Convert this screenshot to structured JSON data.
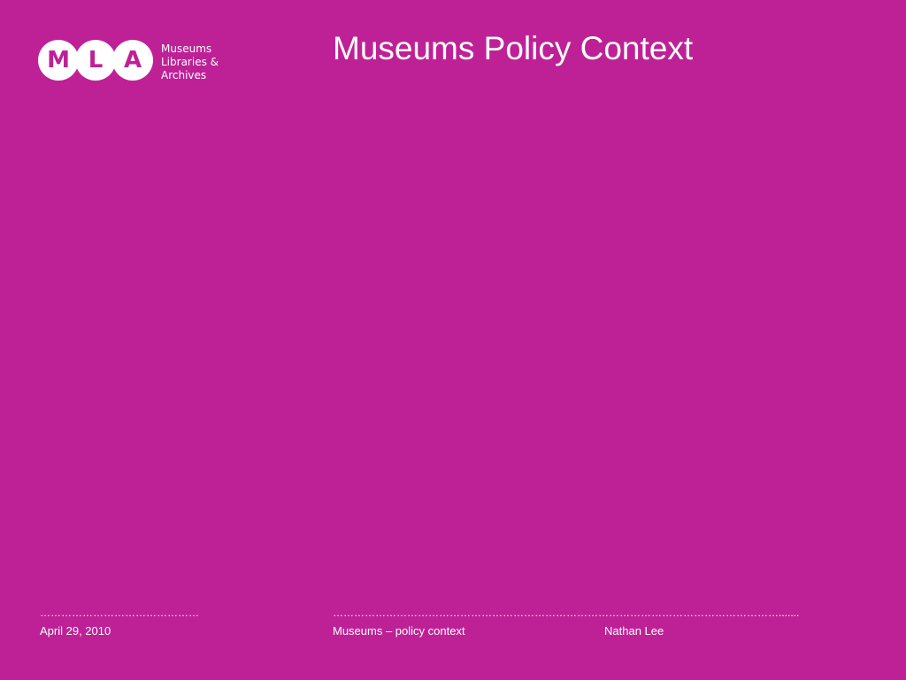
{
  "slide": {
    "background_color": "#be2196",
    "text_color": "#ffffff",
    "title": "Museums Policy Context"
  },
  "logo": {
    "letters": [
      "M",
      "L",
      "A"
    ],
    "text_lines": [
      "Museums",
      "Libraries &",
      "Archives"
    ]
  },
  "footer": {
    "left_divider": "………………………………………",
    "right_divider": "……………………………………………………………………………………………………………….......",
    "date": "April 29, 2010",
    "topic": "Museums – policy context",
    "author": "Nathan Lee"
  }
}
